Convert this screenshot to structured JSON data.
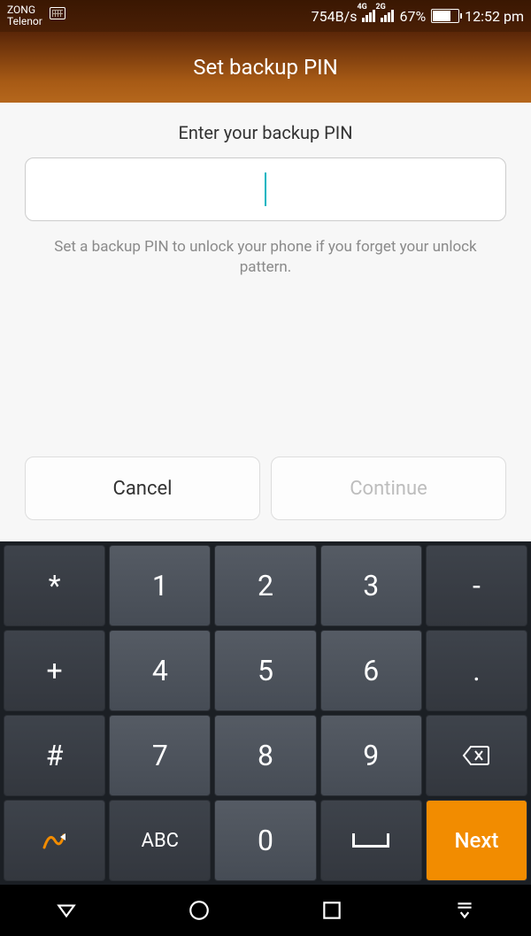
{
  "status": {
    "carrier1": "ZONG",
    "carrier2": "Telenor",
    "data_rate": "754B/s",
    "net1": "4G",
    "net2": "2G",
    "battery_pct": "67%",
    "time": "12:52 pm"
  },
  "header": {
    "title": "Set backup PIN"
  },
  "content": {
    "prompt": "Enter your backup PIN",
    "pin_value": "",
    "helper_text": "Set a backup PIN to unlock your phone if you forget your unlock pattern.",
    "cancel_label": "Cancel",
    "continue_label": "Continue"
  },
  "keyboard": {
    "row1": [
      "*",
      "1",
      "2",
      "3",
      "-"
    ],
    "row2": [
      "+",
      "4",
      "5",
      "6",
      "."
    ],
    "row3": [
      "#",
      "7",
      "8",
      "9"
    ],
    "row4_abc": "ABC",
    "row4_zero": "0",
    "row4_next": "Next"
  }
}
